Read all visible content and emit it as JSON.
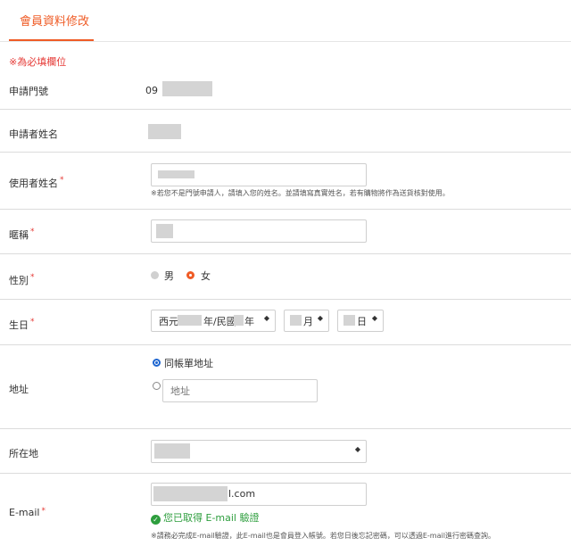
{
  "header": {
    "tab_title": "會員資料修改"
  },
  "required_note": "※為必填欄位",
  "fields": {
    "applicant_number": {
      "label": "申請門號",
      "value_prefix": "09"
    },
    "applicant_name": {
      "label": "申請者姓名"
    },
    "user_name": {
      "label": "使用者姓名",
      "required_mark": "*",
      "hint": "※若您不是門號申請人，請填入您的姓名。並請填寫真實姓名，若有購物將作為送貨核對使用。"
    },
    "nickname": {
      "label": "暱稱",
      "required_mark": "*"
    },
    "gender": {
      "label": "性別",
      "required_mark": "*",
      "options": [
        "男",
        "女"
      ],
      "selected": "女"
    },
    "birthday": {
      "label": "生日",
      "required_mark": "*",
      "year_prefix": "西元",
      "year_mid": "年/民國",
      "year_suffix": "年",
      "month_suffix": "月",
      "day_suffix": "日"
    },
    "address": {
      "label": "地址",
      "option_same": "同帳單地址",
      "placeholder": "地址"
    },
    "location": {
      "label": "所在地"
    },
    "email": {
      "label": "E-mail",
      "required_mark": "*",
      "value_suffix": "l.com",
      "verified_text": "您已取得 E-mail 驗證",
      "hint": "※請務必完成E-mail驗證，此E-mail也是會員登入帳號。若您日後忘記密碼，可以透過E-mail進行密碼查詢。"
    }
  },
  "colors": {
    "accent": "#ef5b25",
    "required": "#e53935",
    "verified": "#2e9e3e",
    "radio_blue": "#1e66d0"
  },
  "icons": {
    "select_caret": "up-down-caret-icon",
    "verified": "check-circle-icon"
  }
}
